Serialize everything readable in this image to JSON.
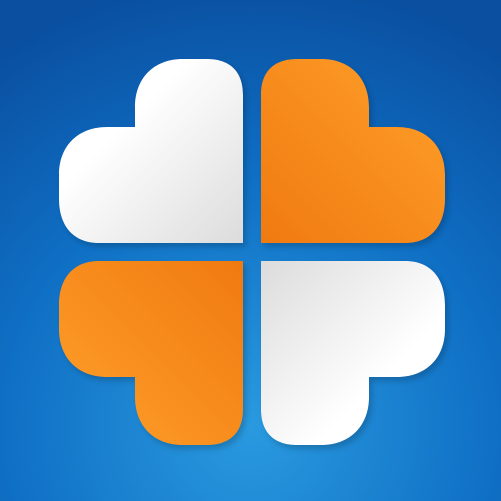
{
  "icon": {
    "name": "four-leaf-clover-logo",
    "background": {
      "center": "#2a9ae0",
      "mid": "#0f6fc4",
      "edge": "#0a4fa0"
    },
    "petals": [
      {
        "name": "top-left-heart-petal",
        "light": "#ffffff",
        "dark": "#dcdcdc",
        "shadow": "#b8b8b8"
      },
      {
        "name": "top-right-heart-petal",
        "light": "#ffa02a",
        "dark": "#f07a10",
        "shadow": "#c85a08"
      },
      {
        "name": "bottom-left-heart-petal",
        "light": "#ffa02a",
        "dark": "#f07a10",
        "shadow": "#c85a08"
      },
      {
        "name": "bottom-right-heart-petal",
        "light": "#ffffff",
        "dark": "#dcdcdc",
        "shadow": "#b8b8b8"
      }
    ]
  }
}
